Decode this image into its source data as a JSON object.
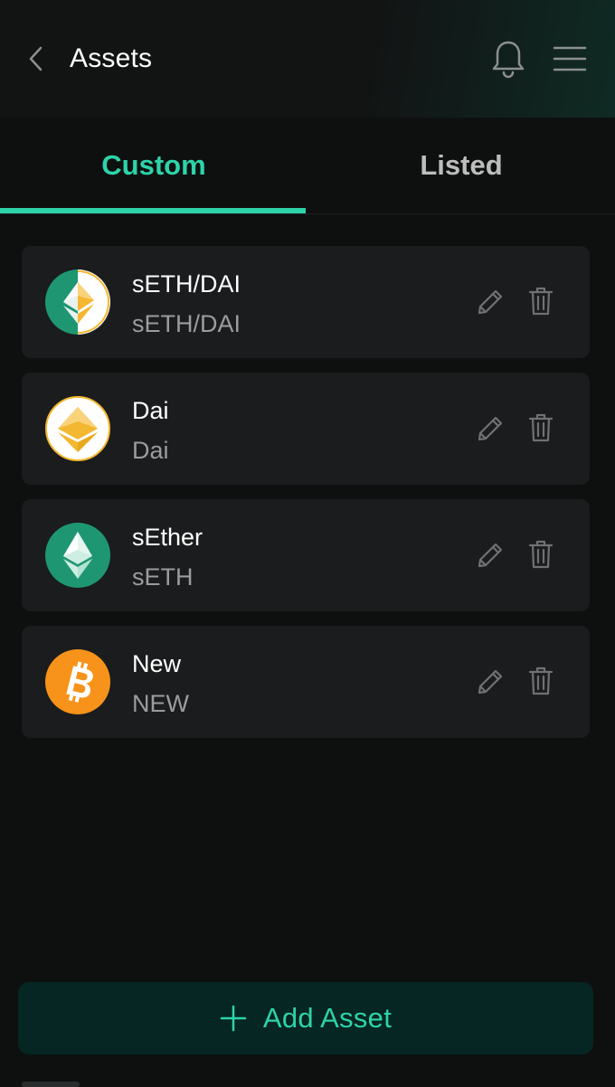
{
  "header": {
    "title": "Assets",
    "back_icon": "chevron-left-icon",
    "bell_icon": "bell-icon",
    "menu_icon": "hamburger-menu-icon"
  },
  "tabs": [
    {
      "label": "Custom",
      "active": true
    },
    {
      "label": "Listed",
      "active": false
    }
  ],
  "assets": [
    {
      "name": "sETH/DAI",
      "symbol": "sETH/DAI",
      "icon": "seth-dai-pair-icon"
    },
    {
      "name": "Dai",
      "symbol": "Dai",
      "icon": "dai-icon"
    },
    {
      "name": "sEther",
      "symbol": "sETH",
      "icon": "ethereum-icon"
    },
    {
      "name": "New",
      "symbol": "NEW",
      "icon": "bitcoin-icon"
    }
  ],
  "actions": {
    "edit_icon": "pencil-icon",
    "delete_icon": "trash-icon"
  },
  "add_button": {
    "label": "Add Asset",
    "icon": "plus-icon"
  },
  "colors": {
    "accent": "#2ed3aa",
    "background": "#0e1010",
    "card": "#1a1c1d",
    "add_button_bg": "#052622",
    "eth_green": "#1f9672",
    "dai_gold": "#f4b731",
    "btc_orange": "#f7931a"
  }
}
